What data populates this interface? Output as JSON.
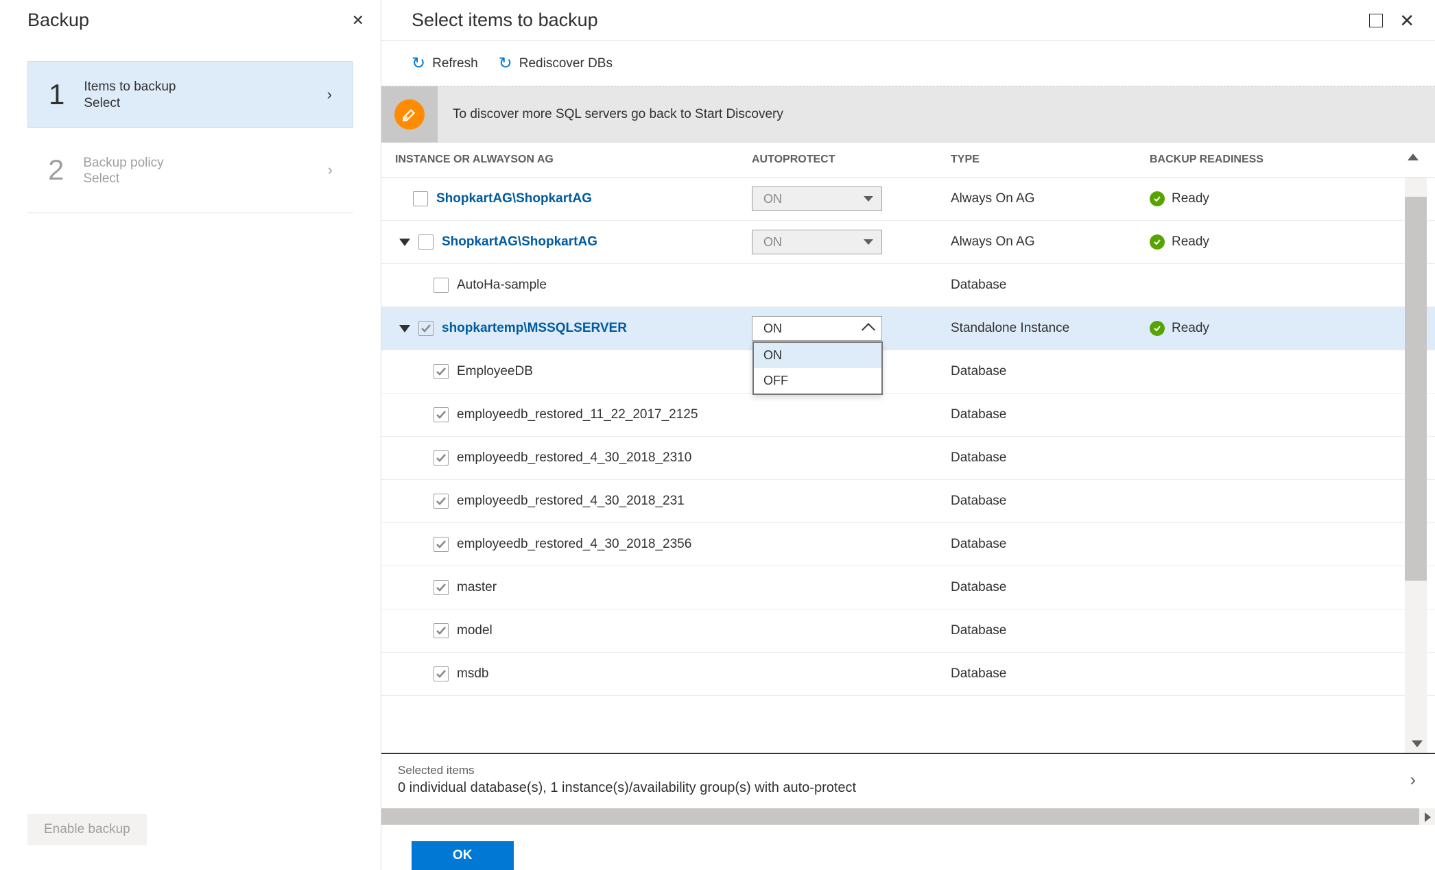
{
  "sidebar": {
    "title": "Backup",
    "steps": [
      {
        "num": "1",
        "title": "Items to backup",
        "sub": "Select",
        "active": true
      },
      {
        "num": "2",
        "title": "Backup policy",
        "sub": "Select",
        "active": false
      }
    ],
    "enable_label": "Enable backup"
  },
  "main": {
    "title": "Select items to backup",
    "toolbar": {
      "refresh": "Refresh",
      "rediscover": "Rediscover DBs"
    },
    "banner": "To discover more SQL servers go back to Start Discovery",
    "columns": {
      "instance": "INSTANCE OR ALWAYSON AG",
      "autoprotect": "AUTOPROTECT",
      "type": "TYPE",
      "readiness": "BACKUP READINESS"
    },
    "autoprotect_value_on": "ON",
    "dropdown_options": [
      "ON",
      "OFF"
    ],
    "rows": [
      {
        "name": "ShopkartAG\\ShopkartAG",
        "indent": 0,
        "caret": false,
        "checked": false,
        "link": true,
        "autoprotect": "ON",
        "autoprotect_disabled": true,
        "type": "Always On AG",
        "ready": "Ready"
      },
      {
        "name": "ShopkartAG\\ShopkartAG",
        "indent": 1,
        "caret": true,
        "checked": false,
        "link": true,
        "autoprotect": "ON",
        "autoprotect_disabled": true,
        "type": "Always On AG",
        "ready": "Ready"
      },
      {
        "name": "AutoHa-sample",
        "indent": 2,
        "caret": false,
        "checked": false,
        "link": false,
        "type": "Database"
      },
      {
        "name": "shopkartemp\\MSSQLSERVER",
        "indent": 1,
        "caret": true,
        "checked": true,
        "link": true,
        "autoprotect": "ON",
        "autoprotect_open": true,
        "type": "Standalone Instance",
        "ready": "Ready",
        "selected": true
      },
      {
        "name": "EmployeeDB",
        "indent": 2,
        "caret": false,
        "checked": true,
        "link": false,
        "type": "Database"
      },
      {
        "name": "employeedb_restored_11_22_2017_2125",
        "indent": 2,
        "caret": false,
        "checked": true,
        "link": false,
        "type": "Database"
      },
      {
        "name": "employeedb_restored_4_30_2018_2310",
        "indent": 2,
        "caret": false,
        "checked": true,
        "link": false,
        "type": "Database"
      },
      {
        "name": "employeedb_restored_4_30_2018_231",
        "indent": 2,
        "caret": false,
        "checked": true,
        "link": false,
        "type": "Database"
      },
      {
        "name": "employeedb_restored_4_30_2018_2356",
        "indent": 2,
        "caret": false,
        "checked": true,
        "link": false,
        "type": "Database"
      },
      {
        "name": "master",
        "indent": 2,
        "caret": false,
        "checked": true,
        "link": false,
        "type": "Database"
      },
      {
        "name": "model",
        "indent": 2,
        "caret": false,
        "checked": true,
        "link": false,
        "type": "Database"
      },
      {
        "name": "msdb",
        "indent": 2,
        "caret": false,
        "checked": true,
        "link": false,
        "type": "Database"
      }
    ],
    "summary": {
      "title": "Selected items",
      "desc": "0 individual database(s), 1 instance(s)/availability group(s) with auto-protect"
    },
    "ok_label": "OK"
  }
}
